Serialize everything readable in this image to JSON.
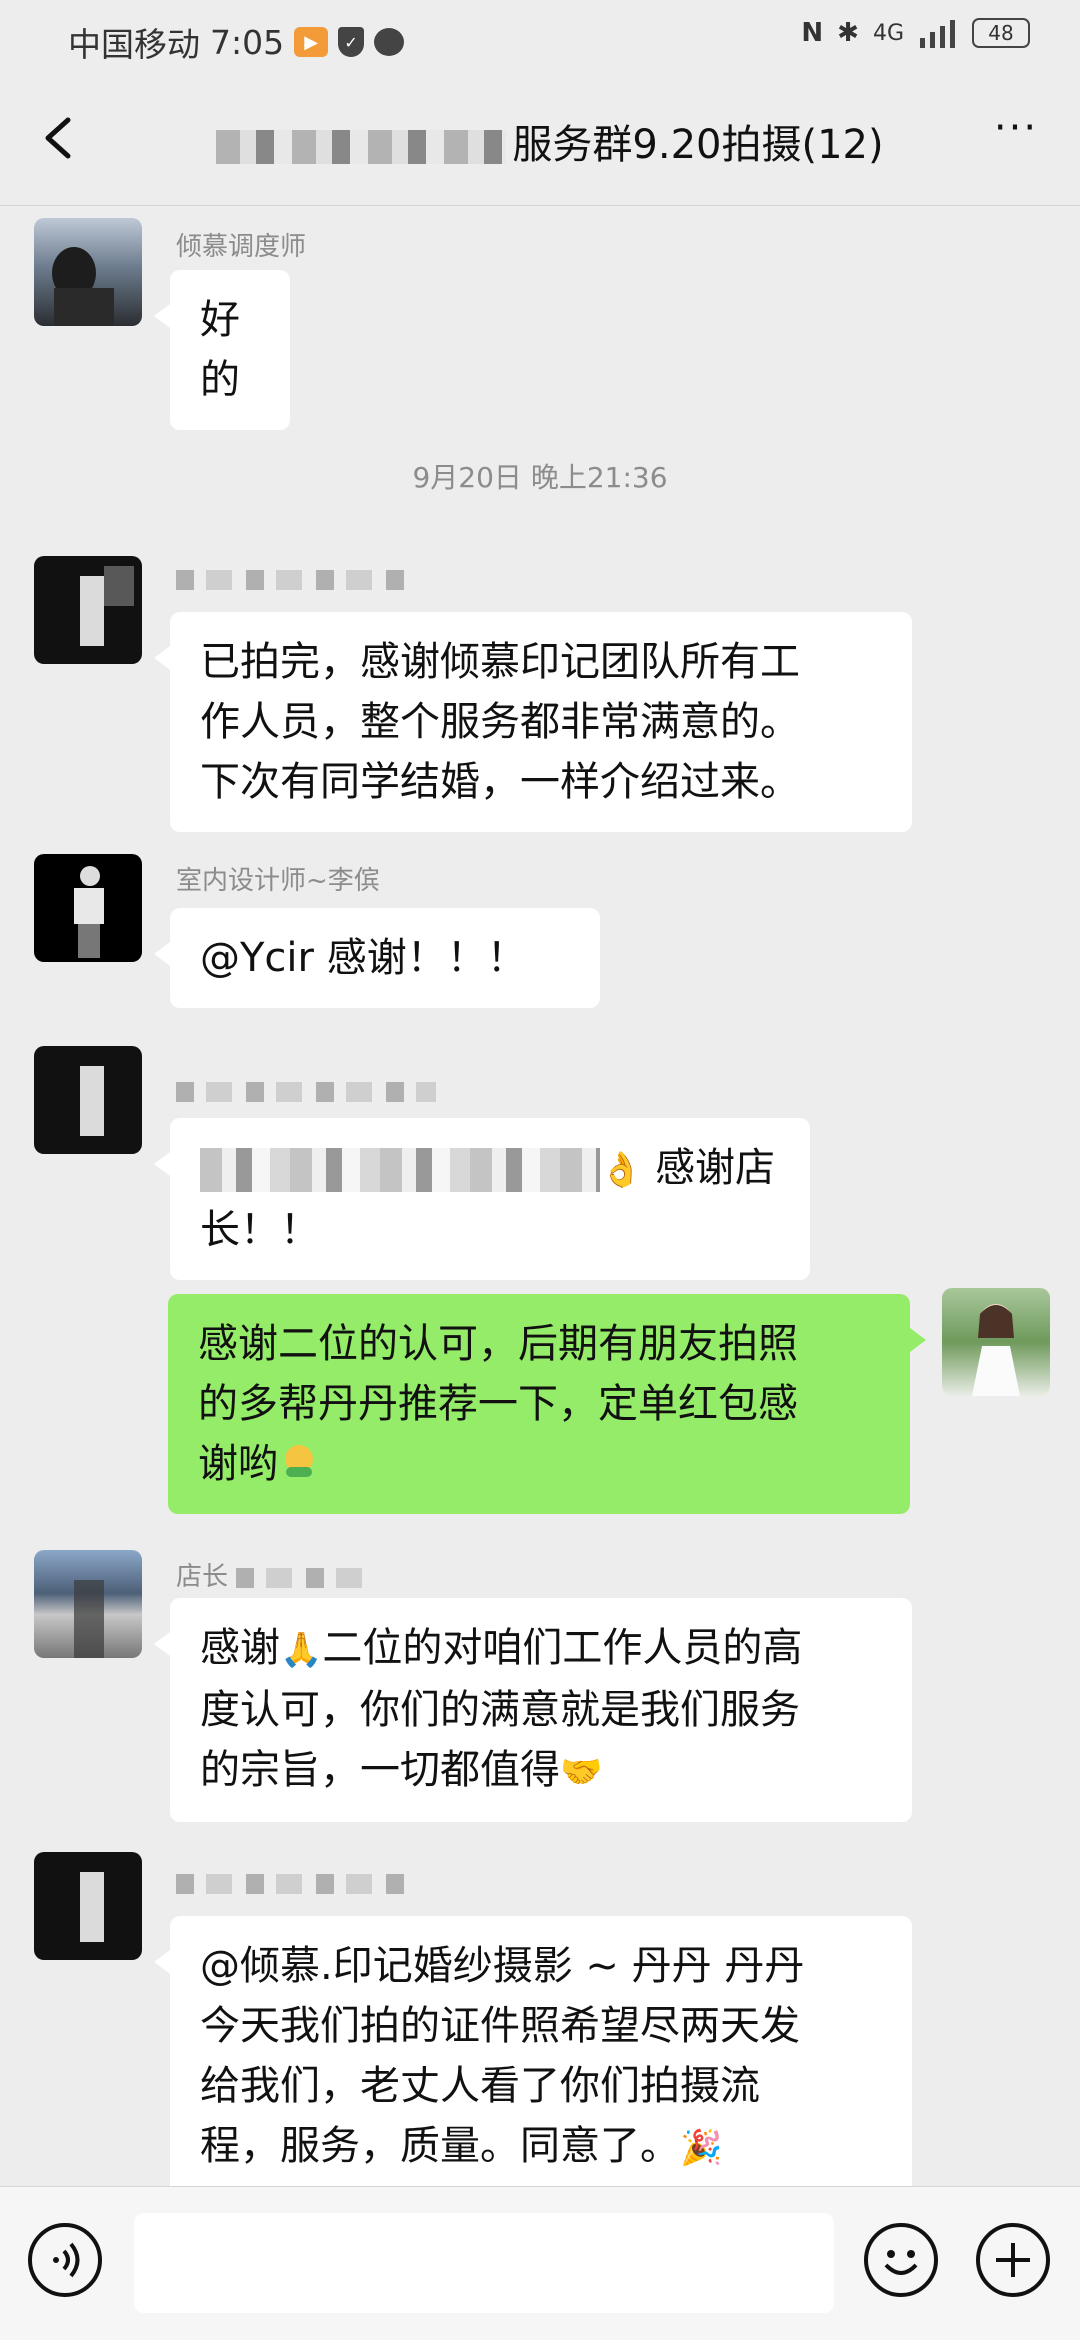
{
  "status_bar": {
    "carrier": "中国移动",
    "time": "7:05",
    "network": "4G",
    "battery": "48"
  },
  "nav": {
    "title": "服务群9.20拍摄(12)",
    "more": "···"
  },
  "messages": [
    {
      "side": "left",
      "sender": "倾慕调度师",
      "text": "好的"
    },
    {
      "timestamp": "9月20日 晚上21:36"
    },
    {
      "side": "left",
      "sender": "",
      "lines": [
        "已拍完，感谢倾慕印记团队所有工",
        "作人员，整个服务都非常满意的。",
        "下次有同学结婚，一样介绍过来。"
      ]
    },
    {
      "side": "left",
      "sender": "室内设计师~李傧",
      "text": "@Ycir  感谢！！！"
    },
    {
      "side": "left",
      "sender": "",
      "line1_visible": "感谢店",
      "line2": "长！！"
    },
    {
      "side": "right",
      "lines": [
        "感谢二位的认可，后期有朋友拍照",
        "的多帮丹丹推荐一下，定单红包感",
        "谢哟"
      ]
    },
    {
      "side": "left",
      "sender": "店长",
      "lines": [
        "感谢",
        "二位的对咱们工作人员的高",
        "度认可，你们的满意就是我们服务",
        "的宗旨，一切都值得"
      ]
    },
    {
      "side": "left",
      "sender": "",
      "lines": [
        "@倾慕.印记婚纱摄影 ~ 丹丹  丹丹",
        "今天我们拍的证件照希望尽两天发",
        "给我们，老丈人看了你们拍摄流",
        "程，服务，质量。同意了。"
      ]
    }
  ],
  "colors": {
    "chat_bg": "#ededed",
    "bubble_left": "#ffffff",
    "bubble_right": "#95ec69"
  }
}
